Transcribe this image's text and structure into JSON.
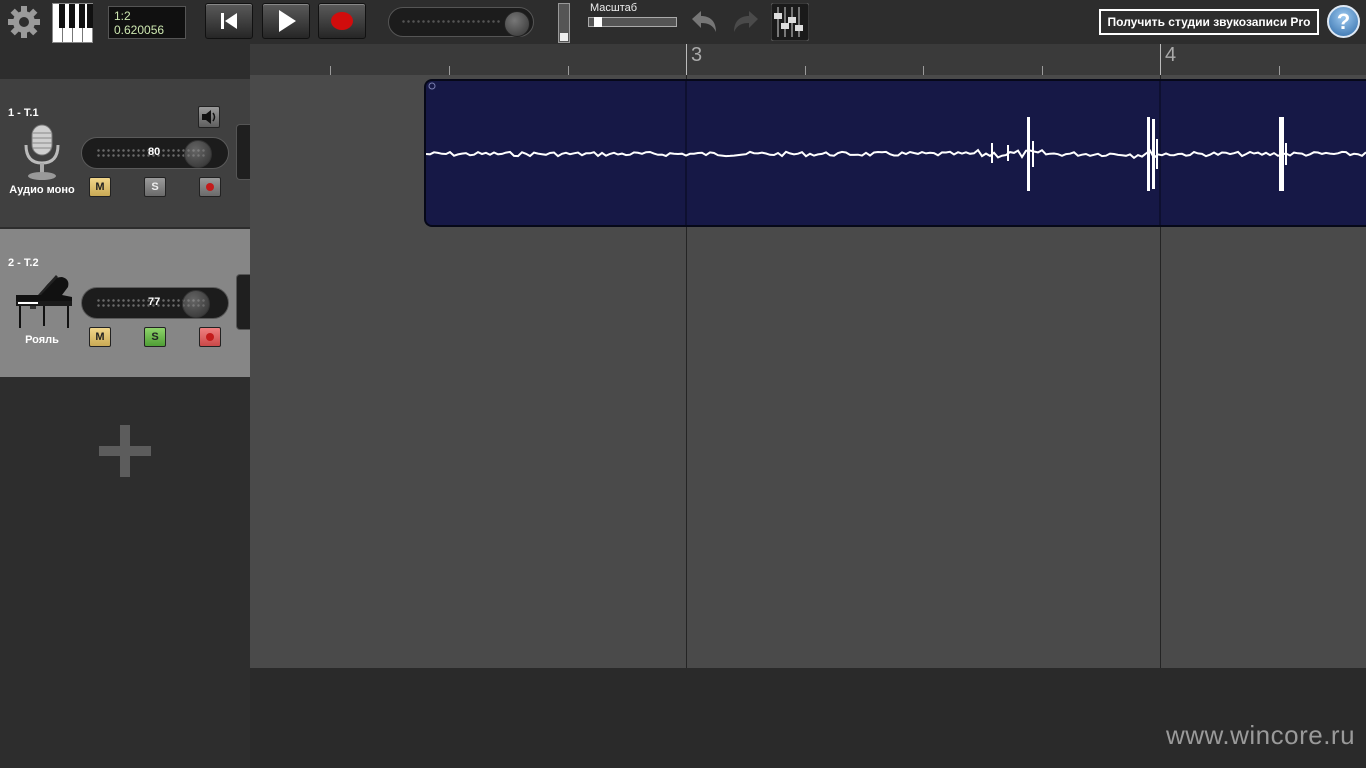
{
  "toolbar": {
    "time_position": "1:2",
    "time_seconds": "0.620056",
    "zoom_label": "Масштаб",
    "pro_button_label": "Получить студии звукозаписи Pro",
    "help_label": "?",
    "icons": {
      "settings": "gear-icon",
      "keyboard": "piano-keys-icon",
      "rewind": "skip-to-start-icon",
      "play": "play-icon",
      "record": "record-icon",
      "undo": "undo-arrow-icon",
      "redo": "redo-arrow-icon",
      "mixer": "mixer-faders-icon"
    }
  },
  "ruler": {
    "bar_labels": [
      "3",
      "4"
    ]
  },
  "tracks": [
    {
      "name": "1 - T.1",
      "instrument": "Аудио моно",
      "volume": "80",
      "mute_label": "M",
      "solo_label": "S",
      "solo_active": false,
      "record_armed": false,
      "icon": "microphone-icon"
    },
    {
      "name": "2 - T.2",
      "instrument": "Рояль",
      "volume": "77",
      "mute_label": "M",
      "solo_label": "S",
      "solo_active": true,
      "record_armed": true,
      "icon": "grand-piano-icon"
    }
  ],
  "colors": {
    "clip_background": "#161846",
    "waveform": "#ffffff",
    "record_red": "#c31b1b"
  },
  "watermark": "www.wincore.ru"
}
